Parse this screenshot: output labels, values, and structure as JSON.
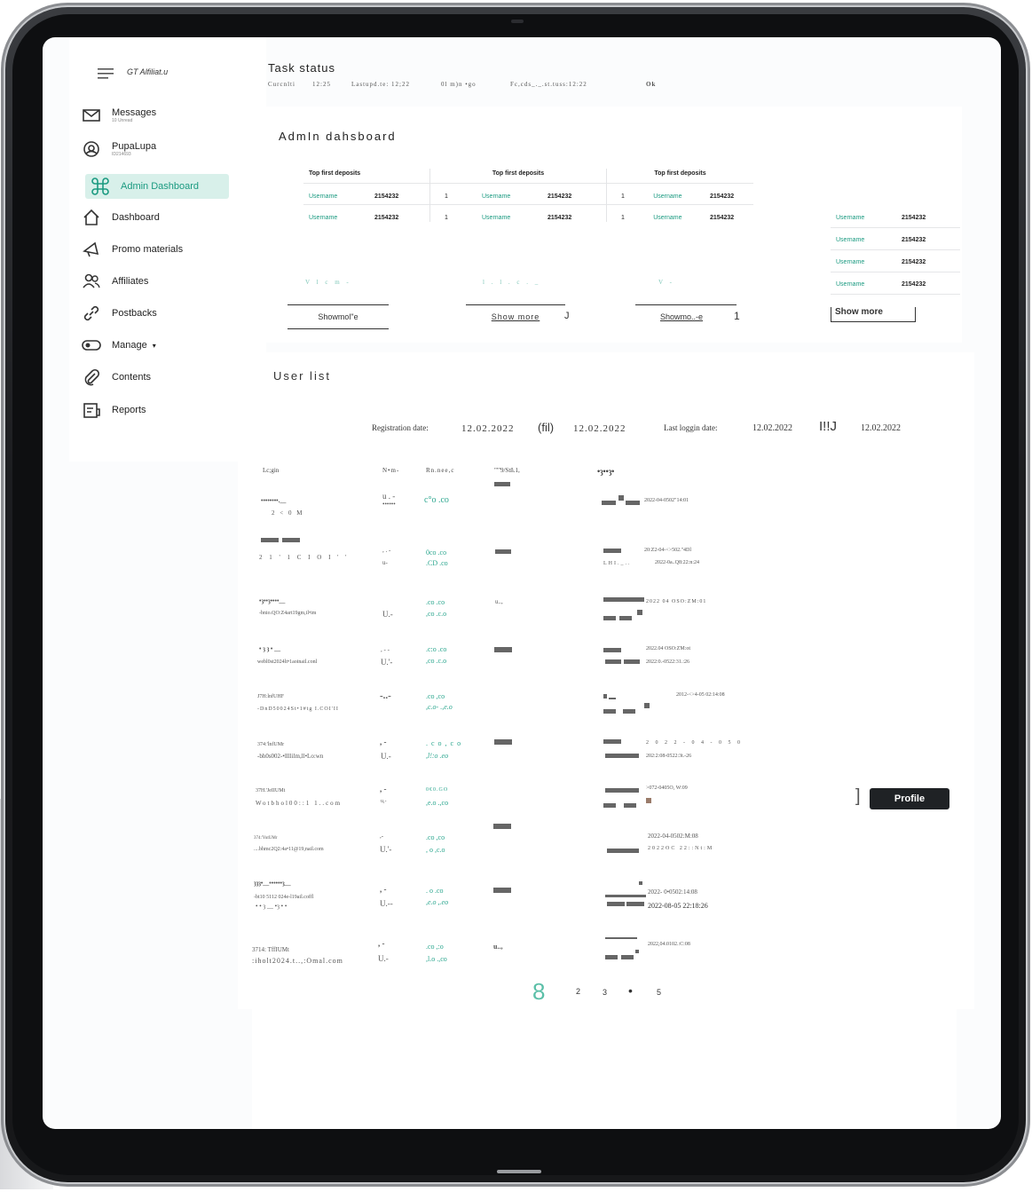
{
  "sidebar": {
    "brand": "GT  Alfiliat.u",
    "items": [
      {
        "label": "Messages",
        "sub": "10 Unread",
        "icon": "mail-icon"
      },
      {
        "label": "PupaLupa",
        "sub": "ID214693",
        "icon": "at-icon"
      },
      {
        "label": "Admin Dashboard",
        "icon": "command-icon",
        "active": true
      },
      {
        "label": "Dashboard",
        "icon": "home-icon"
      },
      {
        "label": "Promo materials",
        "icon": "megaphone-icon"
      },
      {
        "label": "Affiliates",
        "icon": "users-icon"
      },
      {
        "label": "Postbacks",
        "icon": "link-icon"
      },
      {
        "label": "Manage",
        "icon": "toggle-icon"
      },
      {
        "label": "Contents",
        "icon": "paperclip-icon"
      },
      {
        "label": "Reports",
        "icon": "report-icon"
      }
    ]
  },
  "task_status": {
    "title": "Task status",
    "fields": [
      "Curcnlti",
      "12:25",
      "Lastupd.te: 12;22",
      "0l m)n •go",
      "Fc,cds_._.st.tuss:12:22",
      "Ok"
    ]
  },
  "admin": {
    "title": "AdmIn dahsboard",
    "tables": [
      {
        "title": "Top first deposits",
        "rows": [
          [
            "Username",
            "2154232"
          ],
          [
            "Username",
            "2154232"
          ]
        ]
      },
      {
        "title": "Top first deposits",
        "rows": [
          [
            "1",
            "Username",
            "2154232"
          ],
          [
            "1",
            "Username",
            "2154232"
          ]
        ]
      },
      {
        "title": "Top first deposits",
        "rows": [
          [
            "1",
            "Username",
            "2154232"
          ],
          [
            "1",
            "Username",
            "2154232"
          ]
        ]
      }
    ],
    "side_rows": [
      [
        "Username",
        "2154232"
      ],
      [
        "Username",
        "2154232"
      ],
      [
        "Username",
        "2154232"
      ],
      [
        "Username",
        "2154232"
      ]
    ],
    "faint_labels": [
      "V l c m -",
      "l . l . c . _",
      "V -"
    ],
    "show_more": [
      "Showmol\"e",
      "Show more",
      "Showmo..-e",
      "Show more"
    ],
    "trail_marks": [
      "J",
      "1"
    ]
  },
  "user_list": {
    "title": "User list",
    "filters": {
      "reg_label": "Registration date:",
      "reg_from": "12.02.2022",
      "sep1": "(fil)",
      "reg_to": "12.02.2022",
      "last_label": "Last loggin date:",
      "last_from": "12.02.2022",
      "sep2": "I!!J",
      "last_to": "12.02.2022"
    },
    "columns": [
      "Lc;gin",
      "N•m-",
      "Rn.nee,c",
      "\"\"'9/Stñ.1,",
      "•ȝ••ȝ•"
    ],
    "rows": [
      {
        "a": "••••••••.__",
        "b": "2      <     0     M",
        "c": "u  .   -",
        "d": "••••••",
        "e": "c°o  .co",
        "f": "",
        "g": "",
        "h": "2022-04-0502\"14:01"
      },
      {
        "a": "",
        "b": "2   1   ' 1 C I O I ' '",
        "c": ", .  -",
        "d": "u-",
        "e": "0co  .co",
        "f": ".CD .co",
        "g": "",
        "h": "20:Z2-04-<>502.\"4Dl",
        "i": "LHI._..",
        "j": "2022-0a..Q8:22:n:24"
      },
      {
        "a": "•ȝ••ȝ••••__",
        "b": "-bnio.QO:Z4art19gm,il•im",
        "c": "U.-",
        "e": ".co  .co",
        "f": ",co  .c.o",
        "g": "u..,",
        "h": "2022 04  OSO:ZM:01"
      },
      {
        "a": "•  ȝ ȝ  •  __",
        "b": "webl0st2024lt•1aoinail.conl",
        "c": ", - -",
        "d": "U.'-",
        "e": ".c:o  .co",
        "f": ",co  .c.o",
        "h": "2022.04     OSO:ZM:ot",
        "i": "2022:0.-0522:31.:26"
      },
      {
        "a": "J7H:lnfUHF",
        "b": "-DnD50024St•1#tg  I.COI'II",
        "c": "-..-",
        "e": ".co  ,co",
        "f": ",c.o- .,e.o",
        "h": "2012-<>4-05  02:14:08"
      },
      {
        "a": "374:'lnfUMr",
        "b": "-bh0s002-•llllilm,ll•Lo:wn",
        "c": ",  -",
        "d": "U.-",
        "e": ". c o , c o",
        "f": ",l!:o .eo",
        "h": "2 0 2 2 - 0 4 - 0 5 0",
        "i": "202:2:08-0522:3t.-26"
      },
      {
        "a": "37H.'JeIIUMt",
        "b": "Wotbhol00::1  1..com",
        "c": ",  -",
        "d": "u,-",
        "e": "0€0.GO",
        "f": ",e.o  .,co",
        "h": ">072-0405O,  W:09"
      },
      {
        "a": "374:'YutUMr",
        "b": "....bhmc2Q2:4a•11@19,nail.com",
        "c": ",-",
        "d": "U.'-",
        "e": ".co  ,co",
        "f": ", o  ,c.o",
        "h": "2022-04-0502:M:08",
        "i": "2022OC   22::Nt:M"
      },
      {
        "a": "ȝȝȝ•__••••••ȝ__",
        "b": "-bt10  5112 024e-l19ail.coffl",
        "b2": "•  •  ȝ __ •ȝ  •  •",
        "c": ",  -",
        "d": "U.--",
        "e": ".  o  .co",
        "f": ",e.o  ,.eo",
        "h": "2022- 0•0502:14:08",
        "i": "2022-08-05   22:18:26"
      },
      {
        "a": "3714:  TffIUMt",
        "b": ":iholt2024.t..,:Omal.com",
        "c": ",  -",
        "d": "U.-",
        "e": ".co  ,:o",
        "f": ",l.o  .,co",
        "g": "u..,",
        "h": "2022,04.0102.:C:08"
      }
    ],
    "pager": [
      "8",
      "2",
      "3",
      "•",
      "5"
    ],
    "profile_label": "Profile",
    "profile_mark": "]"
  }
}
